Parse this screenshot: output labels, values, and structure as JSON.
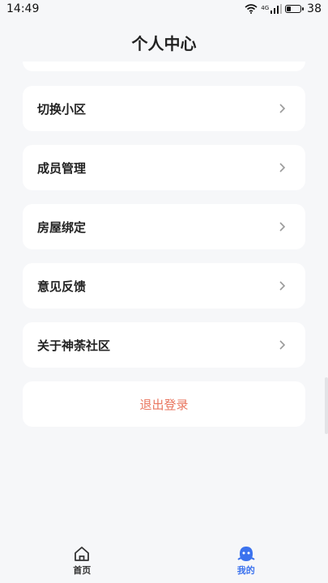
{
  "status_bar": {
    "time": "14:49",
    "network": "4G",
    "battery": "38"
  },
  "page": {
    "title": "个人中心"
  },
  "menu": {
    "items": [
      {
        "label": "切换小区"
      },
      {
        "label": "成员管理"
      },
      {
        "label": "房屋绑定"
      },
      {
        "label": "意见反馈"
      },
      {
        "label": "关于神荼社区"
      }
    ]
  },
  "logout_label": "退出登录",
  "colors": {
    "accent": "#3b72ee",
    "logout_text": "#e9765f",
    "background": "#f6f7f9"
  },
  "tabbar": {
    "tabs": [
      {
        "label": "首页",
        "icon": "home-icon",
        "active": false
      },
      {
        "label": "我的",
        "icon": "profile-icon",
        "active": true
      }
    ]
  }
}
